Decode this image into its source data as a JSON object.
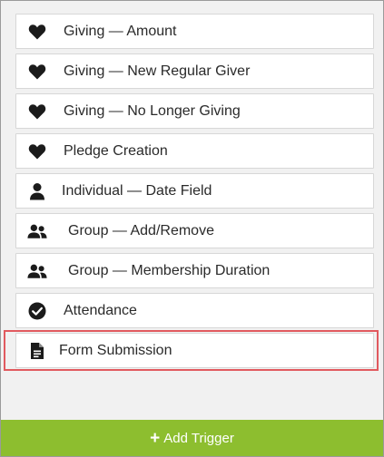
{
  "triggers": [
    {
      "label": "Giving — Amount",
      "icon": "heart-icon"
    },
    {
      "label": "Giving — New Regular Giver",
      "icon": "heart-icon"
    },
    {
      "label": "Giving — No Longer Giving",
      "icon": "heart-icon"
    },
    {
      "label": "Pledge Creation",
      "icon": "heart-icon"
    },
    {
      "label": "Individual — Date Field",
      "icon": "person-icon"
    },
    {
      "label": "Group — Add/Remove",
      "icon": "group-icon"
    },
    {
      "label": "Group — Membership Duration",
      "icon": "group-icon"
    },
    {
      "label": "Attendance",
      "icon": "check-circle-icon"
    },
    {
      "label": "Form Submission",
      "icon": "document-icon"
    }
  ],
  "add_button": {
    "label": "Add Trigger",
    "color": "#8dbe2f"
  },
  "highlight_color": "#e15a5f"
}
